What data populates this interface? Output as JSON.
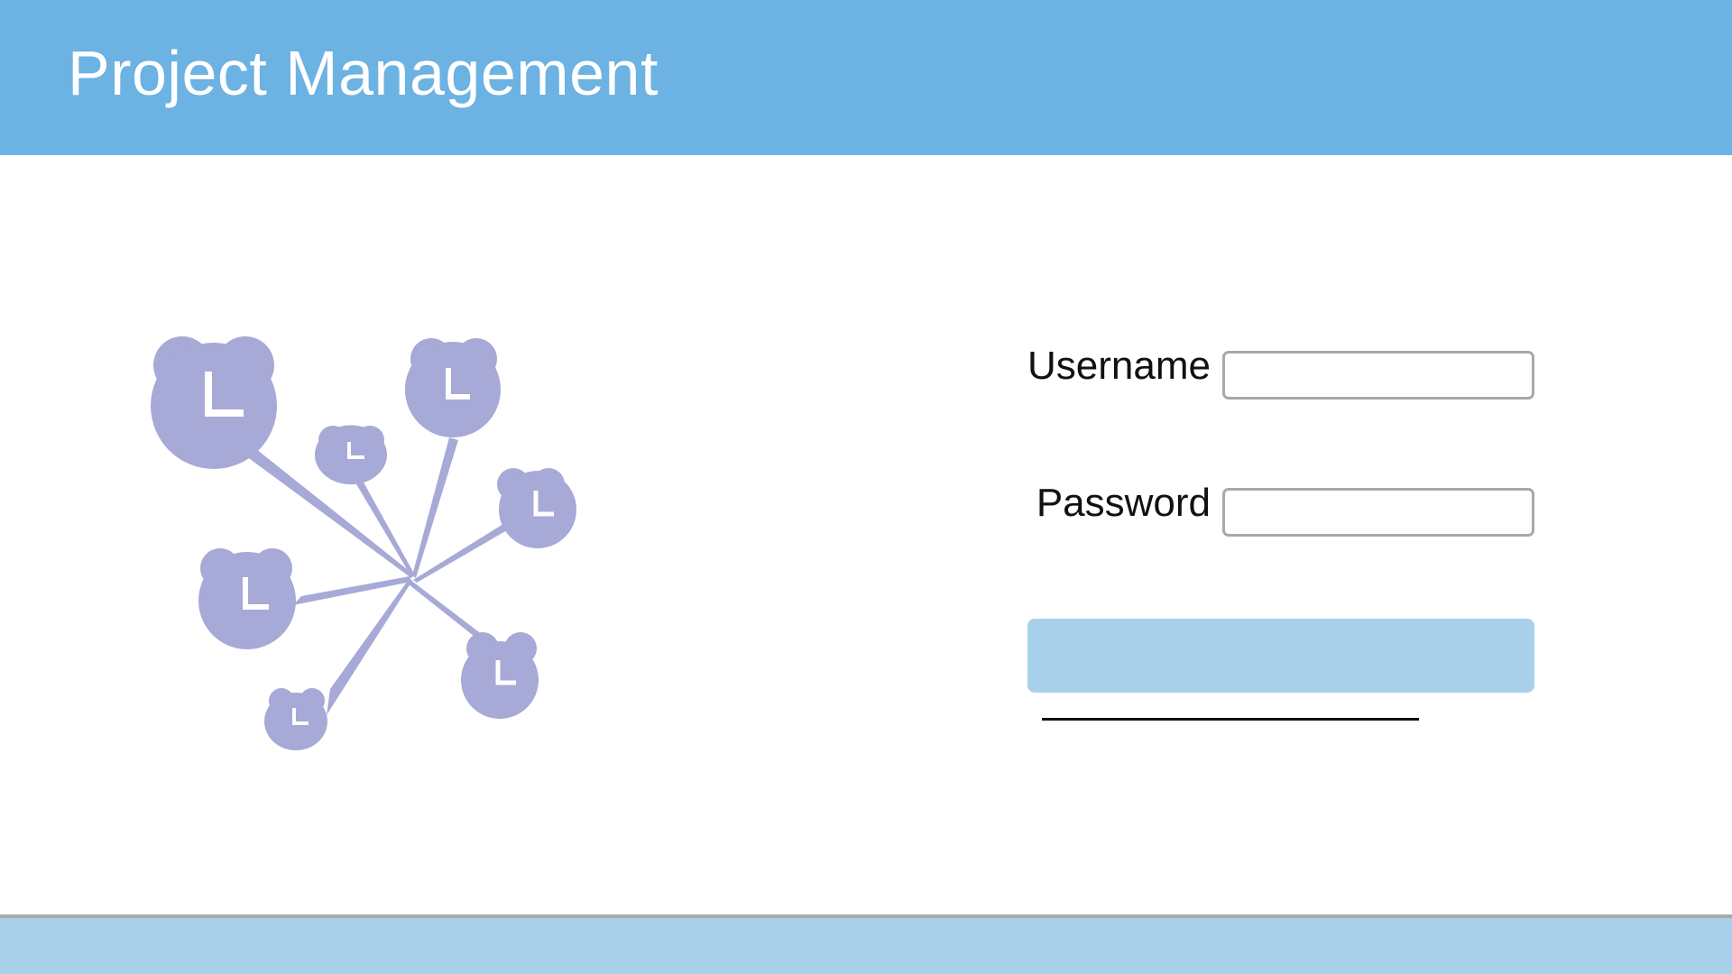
{
  "header": {
    "title": "Project Management",
    "background": "#6cb2e2"
  },
  "illustration": {
    "icon": "team-clock-network-icon",
    "color": "#a7a9d6"
  },
  "login_form": {
    "username_label": "Username",
    "username_value": "",
    "password_label": "Password",
    "password_value": "",
    "submit_button_label": "",
    "submit_button_color": "#a9d0eb",
    "link_text": ""
  },
  "footer": {
    "background": "#a9d0eb"
  }
}
